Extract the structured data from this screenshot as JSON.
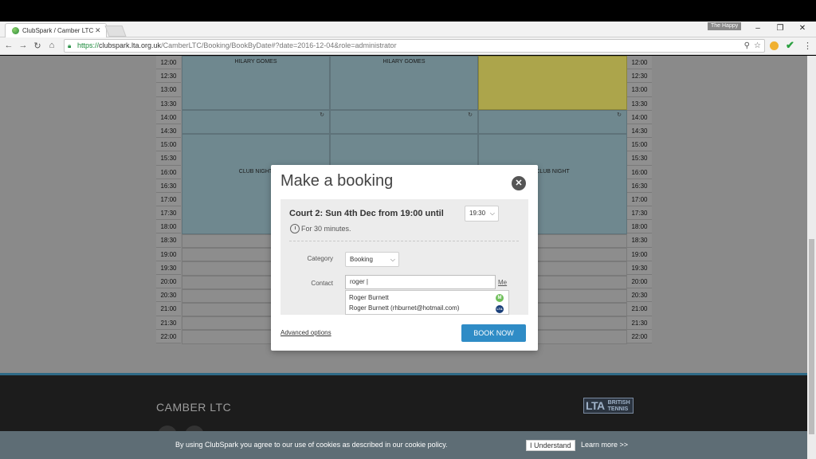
{
  "browser": {
    "tab_title": "ClubSpark / Camber LTC",
    "tab_close": "✕",
    "user_badge": "The Happy",
    "url_https": "https://",
    "url_host": "clubspark.lta.org.uk",
    "url_path": "/CamberLTC/Booking/BookByDate#?date=2016-12-04&role=administrator",
    "icons": [
      "back-icon",
      "forward-icon",
      "reload-icon",
      "home-icon",
      "lock-icon",
      "zoom-icon",
      "star-icon",
      "menu-icon"
    ]
  },
  "schedule": {
    "times": [
      "12:00",
      "12:30",
      "13:00",
      "13:30",
      "14:00",
      "14:30",
      "15:00",
      "15:30",
      "16:00",
      "16:30",
      "17:00",
      "17:30",
      "18:00",
      "18:30",
      "19:00",
      "19:30",
      "20:00",
      "20:30",
      "21:00",
      "21:30",
      "22:00"
    ],
    "labels": {
      "hilary1": "HILARY GOMES",
      "hilary2": "HILARY GOMES",
      "club_night_1": "CLUB NIGHT",
      "club_night_3": "CLUB NIGHT"
    }
  },
  "footer": {
    "title": "CAMBER LTC",
    "logo_lta": "LTA",
    "logo_line1": "BRITISH",
    "logo_line2": "TENNIS"
  },
  "cookie": {
    "text": "By using ClubSpark you agree to our use of cookies as described in our cookie policy.",
    "understand": "I Understand",
    "learn_more": "Learn more >>"
  },
  "modal": {
    "title": "Make a booking",
    "close": "✕",
    "heading": "Court 2: Sun 4th Dec from 19:00 until",
    "end_time": "19:30",
    "duration": "For 30 minutes.",
    "category_label": "Category",
    "category_value": "Booking",
    "contact_label": "Contact",
    "contact_value": "roger |",
    "me_link": "Me",
    "suggestions": [
      {
        "name": "Roger Burnett",
        "badge": "M"
      },
      {
        "name": "Roger Burnett (rhburnet@hotmail.com)",
        "badge": "LTA"
      }
    ],
    "advanced": "Advanced options",
    "book_now": "BOOK NOW"
  },
  "colors": {
    "booked": "#6f888f",
    "highlight": "#aca54b",
    "primary_button": "#2f8cc6",
    "cookie_bar": "#5e6d75"
  }
}
